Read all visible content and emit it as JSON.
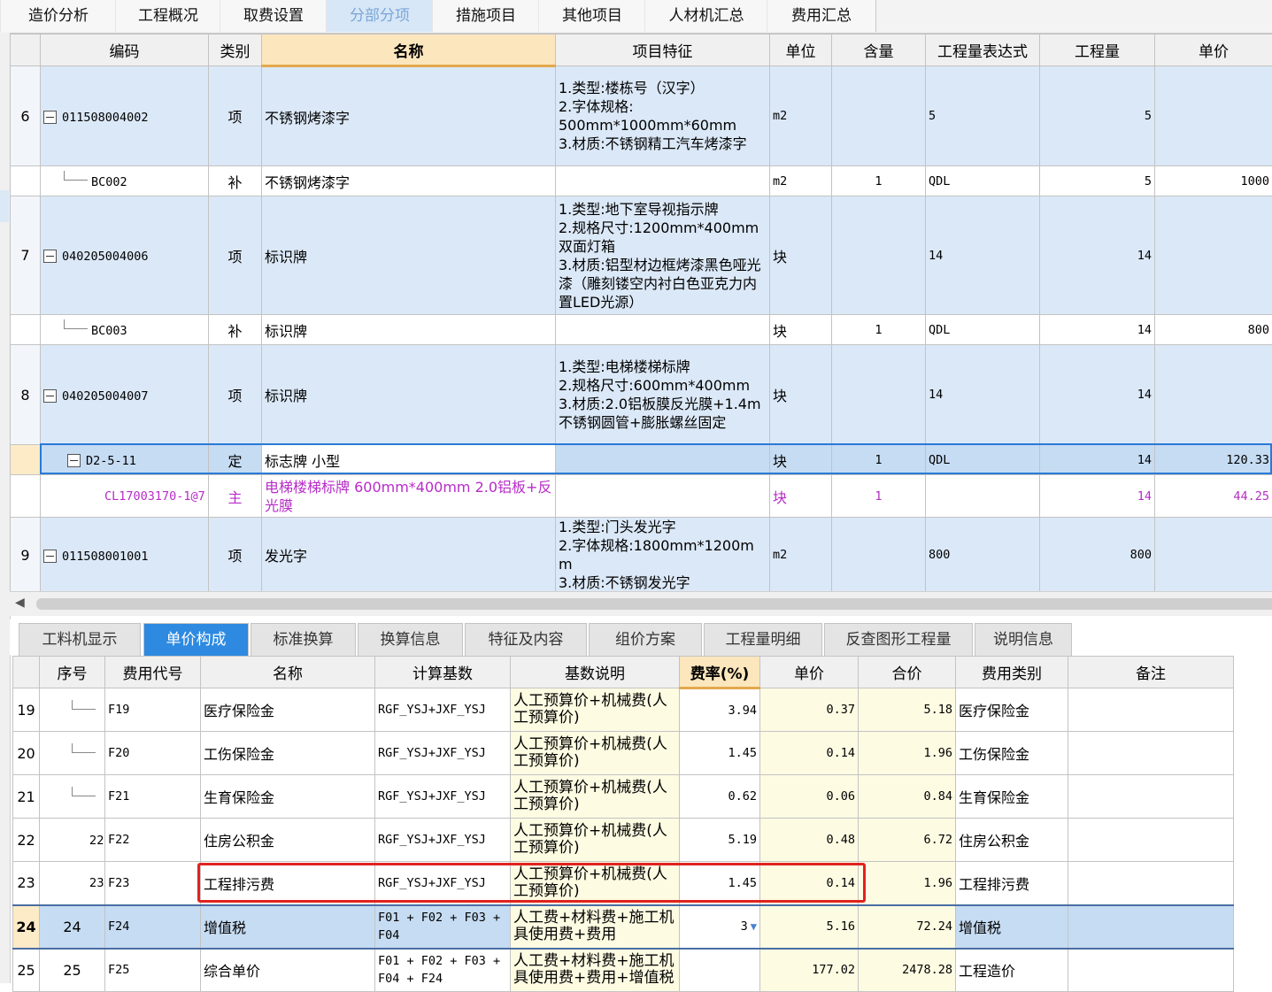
{
  "top_tabs": [
    "造价分析",
    "工程概况",
    "取费设置",
    "分部分项",
    "措施项目",
    "其他项目",
    "人材机汇总",
    "费用汇总"
  ],
  "top_active": "分部分项",
  "upper_table": {
    "headers": [
      "编码",
      "类别",
      "名称",
      "项目特征",
      "单位",
      "含量",
      "工程量表达式",
      "工程量",
      "单价"
    ],
    "rows": [
      {
        "no": "6",
        "code": "011508004002",
        "type": "项",
        "name": "不锈钢烤漆字",
        "feature": "1.类型:楼栋号（汉字）\n2.字体规格:\n500mm*1000mm*60mm\n3.材质:不锈钢精工汽车烤漆字",
        "unit": "m2",
        "content": "",
        "expr": "5",
        "qty": "5",
        "price": ""
      },
      {
        "no": "",
        "code": "BC002",
        "type": "补",
        "name": "不锈钢烤漆字",
        "feature": "",
        "unit": "m2",
        "content": "1",
        "expr": "QDL",
        "qty": "5",
        "price": "1000"
      },
      {
        "no": "7",
        "code": "040205004006",
        "type": "项",
        "name": "标识牌",
        "feature": "1.类型:地下室导视指示牌\n2.规格尺寸:1200mm*400mm 双面灯箱\n3.材质:铝型材边框烤漆黑色哑光漆（雕刻镂空内衬白色亚克力内置LED光源）",
        "unit": "块",
        "content": "",
        "expr": "14",
        "qty": "14",
        "price": ""
      },
      {
        "no": "",
        "code": "BC003",
        "type": "补",
        "name": "标识牌",
        "feature": "",
        "unit": "块",
        "content": "1",
        "expr": "QDL",
        "qty": "14",
        "price": "800"
      },
      {
        "no": "8",
        "code": "040205004007",
        "type": "项",
        "name": "标识牌",
        "feature": "1.类型:电梯楼梯标牌\n2.规格尺寸:600mm*400mm\n3.材质:2.0铝板膜反光膜+1.4m不锈钢圆管+膨胀螺丝固定",
        "unit": "块",
        "content": "",
        "expr": "14",
        "qty": "14",
        "price": ""
      },
      {
        "no": "",
        "code": "D2-5-11",
        "type": "定",
        "name": "标志牌 小型",
        "feature": "",
        "unit": "块",
        "content": "1",
        "expr": "QDL",
        "qty": "14",
        "price": "120.33"
      },
      {
        "no": "",
        "code": "CL17003170-1@7",
        "type": "主",
        "name": "电梯楼梯标牌 600mm*400mm  2.0铝板+反光膜",
        "feature": "",
        "unit": "块",
        "content": "1",
        "expr": "",
        "qty": "14",
        "price": "44.25"
      },
      {
        "no": "9",
        "code": "011508001001",
        "type": "项",
        "name": "发光字",
        "feature": "1.类型:门头发光字\n2.字体规格:1800mm*1200mm\n3.材质:不锈钢发光字",
        "unit": "m2",
        "content": "",
        "expr": "800",
        "qty": "800",
        "price": ""
      }
    ]
  },
  "bottom_tabs": [
    "工料机显示",
    "单价构成",
    "标准换算",
    "换算信息",
    "特征及内容",
    "组价方案",
    "工程量明细",
    "反查图形工程量",
    "说明信息"
  ],
  "bottom_active": "单价构成",
  "lower_table": {
    "headers": [
      "序号",
      "费用代号",
      "名称",
      "计算基数",
      "基数说明",
      "费率(%)",
      "单价",
      "合价",
      "费用类别",
      "备注"
    ],
    "rows": [
      {
        "no": "19",
        "seq": "",
        "code": "F19",
        "name": "医疗保险金",
        "base": "RGF_YSJ+JXF_YSJ",
        "desc": "人工预算价+机械费(人工预算价)",
        "rate": "3.94",
        "price": "0.37",
        "total": "5.18",
        "cat": "医疗保险金",
        "note": ""
      },
      {
        "no": "20",
        "seq": "",
        "code": "F20",
        "name": "工伤保险金",
        "base": "RGF_YSJ+JXF_YSJ",
        "desc": "人工预算价+机械费(人工预算价)",
        "rate": "1.45",
        "price": "0.14",
        "total": "1.96",
        "cat": "工伤保险金",
        "note": ""
      },
      {
        "no": "21",
        "seq": "",
        "code": "F21",
        "name": "生育保险金",
        "base": "RGF_YSJ+JXF_YSJ",
        "desc": "人工预算价+机械费(人工预算价)",
        "rate": "0.62",
        "price": "0.06",
        "total": "0.84",
        "cat": "生育保险金",
        "note": ""
      },
      {
        "no": "22",
        "seq": "22",
        "code": "F22",
        "name": "住房公积金",
        "base": "RGF_YSJ+JXF_YSJ",
        "desc": "人工预算价+机械费(人工预算价)",
        "rate": "5.19",
        "price": "0.48",
        "total": "6.72",
        "cat": "住房公积金",
        "note": ""
      },
      {
        "no": "23",
        "seq": "23",
        "code": "F23",
        "name": "工程排污费",
        "base": "RGF_YSJ+JXF_YSJ",
        "desc": "人工预算价+机械费(人工预算价)",
        "rate": "1.45",
        "price": "0.14",
        "total": "1.96",
        "cat": "工程排污费",
        "note": ""
      },
      {
        "no": "24",
        "seq": "24",
        "code": "F24",
        "name": "增值税",
        "base": "F01 + F02 + F03 + F04",
        "desc": "人工费+材料费+施工机具使用费+费用",
        "rate": "3",
        "price": "5.16",
        "total": "72.24",
        "cat": "增值税",
        "note": ""
      },
      {
        "no": "25",
        "seq": "25",
        "code": "F25",
        "name": "综合单价",
        "base": "F01 + F02 + F03 + F04 + F24",
        "desc": "人工费+材料费+施工机具使用费+费用+增值税",
        "rate": "",
        "price": "177.02",
        "total": "2478.28",
        "cat": "工程造价",
        "note": ""
      }
    ]
  }
}
